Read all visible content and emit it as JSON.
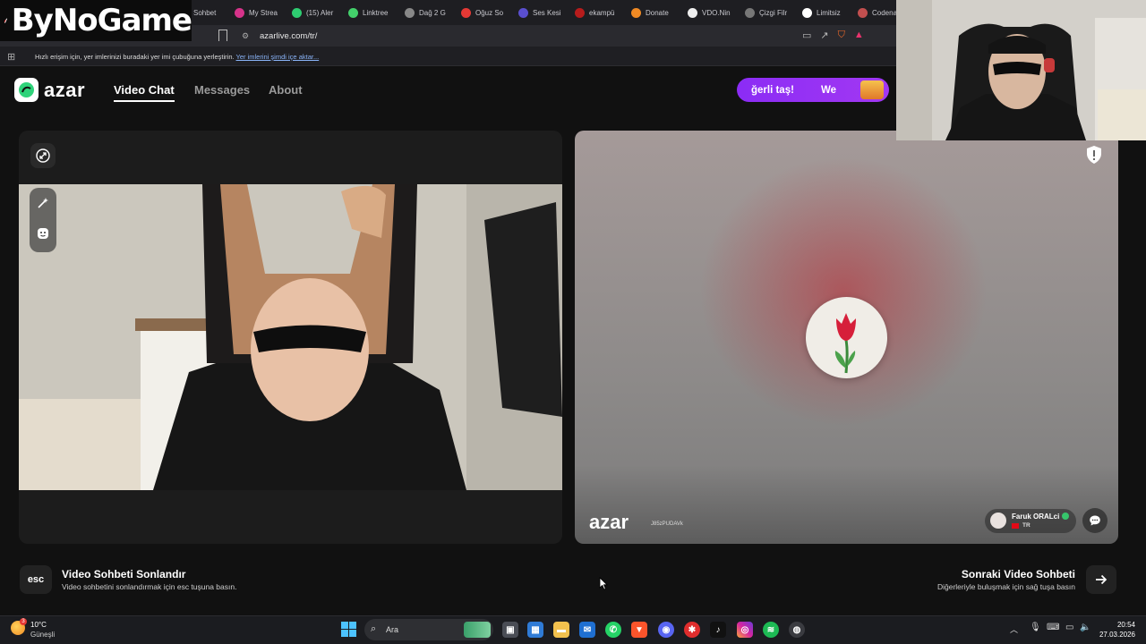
{
  "browser": {
    "tabs": [
      {
        "label": "Sohbet",
        "color": "#d63a3a"
      },
      {
        "label": "My Strea",
        "color": "#d6338a"
      },
      {
        "label": "(15) Aler",
        "color": "#2ecc71"
      },
      {
        "label": "Linktree",
        "color": "#43d16b"
      },
      {
        "label": "Dağ 2 G",
        "color": "#888888"
      },
      {
        "label": "Oğuz So",
        "color": "#e53935"
      },
      {
        "label": "Ses Kesi",
        "color": "#5a4fcf"
      },
      {
        "label": "ekampü",
        "color": "#b71c1c"
      },
      {
        "label": "Donate",
        "color": "#f08a24"
      },
      {
        "label": "VDO.Nin",
        "color": "#eeeeee"
      },
      {
        "label": "Çizgi Filr",
        "color": "#777777"
      },
      {
        "label": "Limitsiz",
        "color": "#ffffff"
      },
      {
        "label": "Codena",
        "color": "#c14f4f"
      }
    ],
    "url": "azarlive.com/tr/",
    "bookmarks_hint": "Hızlı erişim için, yer imlerinizi buradaki yer imi çubuğuna yerleştirin.",
    "bookmarks_link": "Yer imlerini şimdi içe aktar..."
  },
  "overlay_logo": "ByNoGame",
  "azar": {
    "logo_word": "azar",
    "nav": {
      "video_chat": "Video Chat",
      "messages": "Messages",
      "about": "About"
    },
    "promo": {
      "left": "ğerli taş!",
      "right": "We"
    }
  },
  "remote": {
    "watermark": "azar",
    "watermark_id": "J85zPUDAVk",
    "user_name": "Faruk ORALci",
    "user_country": "TR"
  },
  "actions": {
    "esc_key": "esc",
    "end_title": "Video Sohbeti Sonlandır",
    "end_sub": "Video sohbetini sonlandırmak için esc tuşuna basın.",
    "next_title": "Sonraki Video Sohbeti",
    "next_sub": "Diğerleriyle buluşmak için sağ tuşa basın"
  },
  "taskbar": {
    "temp": "10°C",
    "weather": "Güneşli",
    "search": "Ara",
    "time": "20:54",
    "date": "27.03.2026",
    "weather_badge": "3"
  },
  "colors": {
    "accent_purple": "#8b2cf5",
    "azar_green": "#2fd37a",
    "win_blue": "#4cc2ff"
  }
}
